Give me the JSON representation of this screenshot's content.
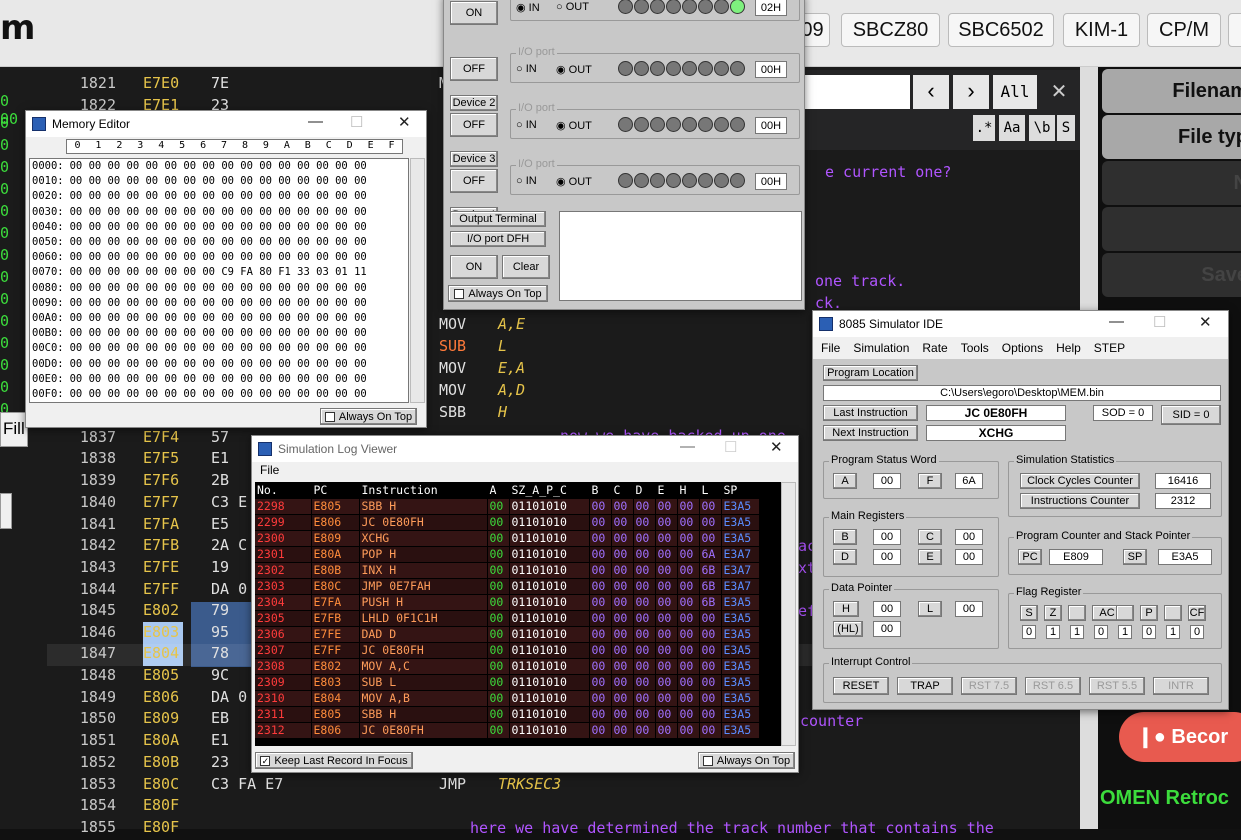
{
  "topbar": {
    "logo": "m",
    "buttons": [
      "09",
      "SBCZ80",
      "SBC6502",
      "KIM-1",
      "CP/M"
    ]
  },
  "listing": {
    "rows": [
      {
        "ln": "1821",
        "addr": "E7E0",
        "bytes": "7E",
        "mn": "M",
        "op": ""
      },
      {
        "ln": "1822",
        "addr": "E7E1",
        "bytes": "23",
        "mn": "",
        "op": ""
      },
      {
        "ln": "1837",
        "addr": "E7F4",
        "bytes": "57",
        "mn": "",
        "op": ""
      },
      {
        "ln": "1838",
        "addr": "E7F5",
        "bytes": "E1",
        "mn": "",
        "op": ""
      },
      {
        "ln": "1839",
        "addr": "E7F6",
        "bytes": "2B",
        "mn": "",
        "op": ""
      },
      {
        "ln": "1840",
        "addr": "E7F7",
        "bytes": "C3 E",
        "mn": "",
        "op": ""
      },
      {
        "ln": "1841",
        "addr": "E7FA",
        "bytes": "E5",
        "mn": "",
        "op": ""
      },
      {
        "ln": "1842",
        "addr": "E7FB",
        "bytes": "2A C",
        "mn": "",
        "op": ""
      },
      {
        "ln": "1843",
        "addr": "E7FE",
        "bytes": "19",
        "mn": "",
        "op": ""
      },
      {
        "ln": "1844",
        "addr": "E7FF",
        "bytes": "DA 0",
        "mn": "",
        "op": ""
      },
      {
        "ln": "1845",
        "addr": "E802",
        "bytes": "79",
        "mn": "",
        "op": ""
      },
      {
        "ln": "1846",
        "addr": "E803",
        "bytes": "95",
        "mn": "",
        "op": ""
      },
      {
        "ln": "1847",
        "addr": "E804",
        "bytes": "78",
        "mn": "",
        "op": ""
      },
      {
        "ln": "1848",
        "addr": "E805",
        "bytes": "9C",
        "mn": "",
        "op": ""
      },
      {
        "ln": "1849",
        "addr": "E806",
        "bytes": "DA 0",
        "mn": "",
        "op": ""
      },
      {
        "ln": "1850",
        "addr": "E809",
        "bytes": "EB",
        "mn": "",
        "op": ""
      },
      {
        "ln": "1851",
        "addr": "E80A",
        "bytes": "E1",
        "mn": "",
        "op": ""
      },
      {
        "ln": "1852",
        "addr": "E80B",
        "bytes": "23",
        "mn": "",
        "op": ""
      },
      {
        "ln": "1853",
        "addr": "E80C",
        "bytes": "C3 FA E7",
        "mn": "JMP",
        "op": "TRKSEC3"
      },
      {
        "ln": "1854",
        "addr": "E80F",
        "bytes": "",
        "mn": "",
        "op": ""
      },
      {
        "ln": "1855",
        "addr": "E80F",
        "bytes": "",
        "mn": "",
        "op": ""
      }
    ],
    "mid": [
      {
        "mn": "MOV",
        "op": "A,E",
        "sub": false
      },
      {
        "mn": "SUB",
        "op": "L",
        "sub": true
      },
      {
        "mn": "MOV",
        "op": "E,A",
        "sub": false
      },
      {
        "mn": "MOV",
        "op": "A,D",
        "sub": false
      },
      {
        "mn": "SBB",
        "op": "H",
        "sub": false
      }
    ],
    "left_margin": [
      "0 00",
      "0",
      "0",
      "0",
      "0",
      "0",
      "0",
      "0",
      "0",
      "0",
      "0",
      "0",
      "0",
      "0",
      "0"
    ],
    "fill_label": "Fill",
    "comments": {
      "c1": "e current one?",
      "c2": "one track.",
      "c3": "ck.",
      "c4": "counter",
      "c5": "here we have determined the track number that contains the",
      "c6": "now we have backed up one",
      "c7": "ac",
      "c8": "xt",
      "c9": "ef"
    }
  },
  "search": {
    "next_label": "All",
    "opt1": ".*",
    "opt2": "Aa",
    "opt3": "\\b",
    "opt4": "S"
  },
  "rightpanel": {
    "items": [
      "Filenam",
      "File typ",
      "N",
      "",
      "Save",
      "",
      "",
      "M",
      "",
      "",
      "",
      "",
      "",
      "",
      "la"
    ],
    "patreon": "Becor",
    "omen": "OMEN Retroc"
  },
  "memory_editor": {
    "title": "Memory Editor",
    "cols": [
      "0",
      "1",
      "2",
      "3",
      "4",
      "5",
      "6",
      "7",
      "8",
      "9",
      "A",
      "B",
      "C",
      "D",
      "E",
      "F"
    ],
    "rows": [
      {
        "a": "0000:",
        "v": "00 00 00 00 00 00 00 00 00 00 00 00 00 00 00 00"
      },
      {
        "a": "0010:",
        "v": "00 00 00 00 00 00 00 00 00 00 00 00 00 00 00 00"
      },
      {
        "a": "0020:",
        "v": "00 00 00 00 00 00 00 00 00 00 00 00 00 00 00 00"
      },
      {
        "a": "0030:",
        "v": "00 00 00 00 00 00 00 00 00 00 00 00 00 00 00 00"
      },
      {
        "a": "0040:",
        "v": "00 00 00 00 00 00 00 00 00 00 00 00 00 00 00 00"
      },
      {
        "a": "0050:",
        "v": "00 00 00 00 00 00 00 00 00 00 00 00 00 00 00 00"
      },
      {
        "a": "0060:",
        "v": "00 00 00 00 00 00 00 00 00 00 00 00 00 00 00 00"
      },
      {
        "a": "0070:",
        "v": "00 00 00 00 00 00 00 00 C9 FA 80 F1 33 03 01 11"
      },
      {
        "a": "0080:",
        "v": "00 00 00 00 00 00 00 00 00 00 00 00 00 00 00 00"
      },
      {
        "a": "0090:",
        "v": "00 00 00 00 00 00 00 00 00 00 00 00 00 00 00 00"
      },
      {
        "a": "00A0:",
        "v": "00 00 00 00 00 00 00 00 00 00 00 00 00 00 00 00"
      },
      {
        "a": "00B0:",
        "v": "00 00 00 00 00 00 00 00 00 00 00 00 00 00 00 00"
      },
      {
        "a": "00C0:",
        "v": "00 00 00 00 00 00 00 00 00 00 00 00 00 00 00 00"
      },
      {
        "a": "00D0:",
        "v": "00 00 00 00 00 00 00 00 00 00 00 00 00 00 00 00"
      },
      {
        "a": "00E0:",
        "v": "00 00 00 00 00 00 00 00 00 00 00 00 00 00 00 00"
      },
      {
        "a": "00F0:",
        "v": "00 00 00 00 00 00 00 00 00 00 00 00 00 00 00 00"
      }
    ],
    "always_on_top": "Always On Top"
  },
  "io_window": {
    "devices": [
      {
        "name": "",
        "btn": "ON",
        "in": true,
        "port": "02H",
        "lit": 7
      },
      {
        "name": "Device 2",
        "btn": "OFF",
        "in": false,
        "port": "00H",
        "lit": -1
      },
      {
        "name": "Device 3",
        "btn": "OFF",
        "in": false,
        "port": "00H",
        "lit": -1
      },
      {
        "name": "Device 4",
        "btn": "OFF",
        "in": false,
        "port": "00H",
        "lit": -1
      }
    ],
    "io_port": "I/O port",
    "in_label": "IN",
    "out_label": "OUT",
    "output_terminal": "Output Terminal",
    "io_port_dfh": "I/O port DFH",
    "on": "ON",
    "clear": "Clear",
    "always_on_top": "Always On Top"
  },
  "sim_ide": {
    "title": "8085 Simulator IDE",
    "menu": [
      "File",
      "Simulation",
      "Rate",
      "Tools",
      "Options",
      "Help",
      "STEP"
    ],
    "program_location_btn": "Program Location",
    "path": "C:\\Users\\egoro\\Desktop\\MEM.bin",
    "last_instr_btn": "Last Instruction",
    "last_instr": "JC 0E80FH",
    "next_instr_btn": "Next Instruction",
    "next_instr": "XCHG",
    "sod": "SOD = 0",
    "sid": "SID = 0",
    "psw_title": "Program Status Word",
    "a": "A",
    "a_val": "00",
    "f": "F",
    "f_val": "6A",
    "stats_title": "Simulation Statistics",
    "ccc_btn": "Clock Cycles Counter",
    "ccc": "16416",
    "ic_btn": "Instructions Counter",
    "ic": "2312",
    "main_regs_title": "Main Registers",
    "b": "B",
    "b_val": "00",
    "c": "C",
    "c_val": "00",
    "d": "D",
    "d_val": "00",
    "e": "E",
    "e_val": "00",
    "pcsp_title": "Program Counter and Stack Pointer",
    "pc": "PC",
    "pc_val": "E809",
    "sp": "SP",
    "sp_val": "E3A5",
    "dp_title": "Data Pointer",
    "h": "H",
    "h_val": "00",
    "l": "L",
    "l_val": "00",
    "hl": "(HL)",
    "hl_val": "00",
    "flag_title": "Flag Register",
    "flag_names": [
      "S",
      "Z",
      "",
      "AC",
      "",
      "P",
      "",
      "CF"
    ],
    "flag_vals": [
      "0",
      "1",
      "1",
      "0",
      "1",
      "0",
      "1",
      "0"
    ],
    "int_title": "Interrupt Control",
    "int_btns": [
      "RESET",
      "TRAP",
      "RST 7.5",
      "RST 6.5",
      "RST 5.5",
      "INTR"
    ]
  },
  "log": {
    "title": "Simulation Log Viewer",
    "menu": "File",
    "headers": [
      "No.",
      "PC",
      "Instruction",
      "A",
      "SZ_A_P_C",
      "B",
      "C",
      "D",
      "E",
      "H",
      "L",
      "SP"
    ],
    "rows": [
      [
        "2298",
        "E805",
        "SBB H",
        "00",
        "01101010",
        "00",
        "00",
        "00",
        "00",
        "00",
        "00",
        "E3A5"
      ],
      [
        "2299",
        "E806",
        "JC 0E80FH",
        "00",
        "01101010",
        "00",
        "00",
        "00",
        "00",
        "00",
        "00",
        "E3A5"
      ],
      [
        "2300",
        "E809",
        "XCHG",
        "00",
        "01101010",
        "00",
        "00",
        "00",
        "00",
        "00",
        "00",
        "E3A5"
      ],
      [
        "2301",
        "E80A",
        "POP H",
        "00",
        "01101010",
        "00",
        "00",
        "00",
        "00",
        "00",
        "6A",
        "E3A7"
      ],
      [
        "2302",
        "E80B",
        "INX H",
        "00",
        "01101010",
        "00",
        "00",
        "00",
        "00",
        "00",
        "6B",
        "E3A7"
      ],
      [
        "2303",
        "E80C",
        "JMP 0E7FAH",
        "00",
        "01101010",
        "00",
        "00",
        "00",
        "00",
        "00",
        "6B",
        "E3A7"
      ],
      [
        "2304",
        "E7FA",
        "PUSH H",
        "00",
        "01101010",
        "00",
        "00",
        "00",
        "00",
        "00",
        "6B",
        "E3A5"
      ],
      [
        "2305",
        "E7FB",
        "LHLD 0F1C1H",
        "00",
        "01101010",
        "00",
        "00",
        "00",
        "00",
        "00",
        "00",
        "E3A5"
      ],
      [
        "2306",
        "E7FE",
        "DAD D",
        "00",
        "01101010",
        "00",
        "00",
        "00",
        "00",
        "00",
        "00",
        "E3A5"
      ],
      [
        "2307",
        "E7FF",
        "JC 0E80FH",
        "00",
        "01101010",
        "00",
        "00",
        "00",
        "00",
        "00",
        "00",
        "E3A5"
      ],
      [
        "2308",
        "E802",
        "MOV A,C",
        "00",
        "01101010",
        "00",
        "00",
        "00",
        "00",
        "00",
        "00",
        "E3A5"
      ],
      [
        "2309",
        "E803",
        "SUB L",
        "00",
        "01101010",
        "00",
        "00",
        "00",
        "00",
        "00",
        "00",
        "E3A5"
      ],
      [
        "2310",
        "E804",
        "MOV A,B",
        "00",
        "01101010",
        "00",
        "00",
        "00",
        "00",
        "00",
        "00",
        "E3A5"
      ],
      [
        "2311",
        "E805",
        "SBB H",
        "00",
        "01101010",
        "00",
        "00",
        "00",
        "00",
        "00",
        "00",
        "E3A5"
      ],
      [
        "2312",
        "E806",
        "JC 0E80FH",
        "00",
        "01101010",
        "00",
        "00",
        "00",
        "00",
        "00",
        "00",
        "E3A5"
      ]
    ],
    "keep_last": "Keep Last Record In Focus",
    "always_on_top": "Always On Top"
  },
  "colors": {
    "log_no": "#ff3b3b",
    "log_pc": "#ff8c3b",
    "log_instr": "#ff9c5a",
    "log_a": "#3cdc3c",
    "log_flags": "#ffffff",
    "log_reg": "#a070ff",
    "log_sp": "#5a8cff"
  }
}
